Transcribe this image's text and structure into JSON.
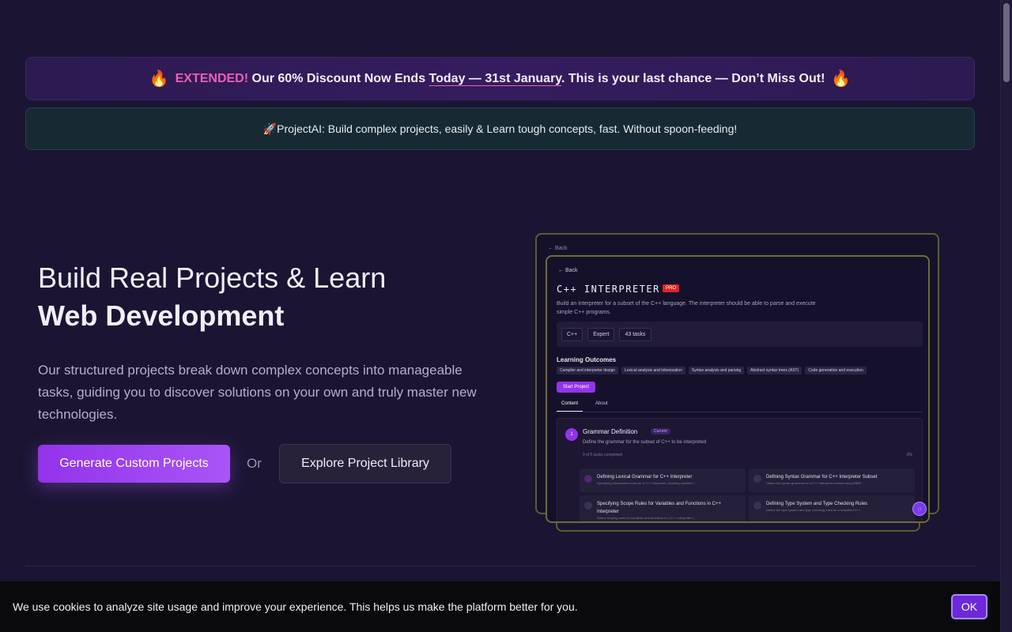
{
  "promo": {
    "flame_icon": "🔥",
    "extended": "EXTENDED!",
    "text_before": "Our 60% Discount Now Ends",
    "today": "Today — 31st January",
    "text_after": ". This is your last chance — Don’t Miss Out!"
  },
  "tagline": {
    "rocket_icon": "🚀",
    "text": "ProjectAI: Build complex projects, easily & Learn tough concepts, fast. Without spoon-feeding!"
  },
  "hero": {
    "title_line1": "Build Real Projects & Learn",
    "title_line2": "Web Development",
    "description": "Our structured projects break down complex concepts into manageable tasks, guiding you to discover solutions on your own and truly master new technologies.",
    "primary_button": "Generate Custom Projects",
    "or_text": "Or",
    "secondary_button": "Explore Project Library"
  },
  "preview": {
    "back_outer": "← Back",
    "back": "← Back",
    "title": "C++ INTERPRETER",
    "pro_badge": "PRO",
    "description": "Build an interpreter for a subset of the C++ language. The interpreter should be able to parse and execute simple C++ programs.",
    "badges": [
      "C++",
      "Expert",
      "43 tasks"
    ],
    "outcomes_heading": "Learning Outcomes",
    "outcomes": [
      "Compiler and interpreter design",
      "Lexical analysis and tokenization",
      "Syntax analysis and parsing",
      "Abstract syntax trees (AST)",
      "Code generation and execution"
    ],
    "start_button": "Start Project",
    "tabs": [
      "Content",
      "About"
    ],
    "section": {
      "number": "1",
      "title": "Grammar Definition",
      "status": "Current",
      "description": "Define the grammar for the subset of C++ to be interpreted",
      "progress": "0 of 5 tasks completed",
      "percent": "0%"
    },
    "tasks": [
      {
        "title": "Defining Lexical Grammar for C++ Interpreter",
        "desc": "Specifying tokenization rules for a C++ interpreter, including identifier..."
      },
      {
        "title": "Defining Syntax Grammar for C++ Interpreter Subset",
        "desc": "Define the syntax grammar for a C++ interpreter subset using EBNF..."
      },
      {
        "title": "Specifying Scope Rules for Variables and Functions in C++ Interpreter",
        "desc": "Define scoping rules for variables and functions in a C++ interpreter t..."
      },
      {
        "title": "Defining Type System and Type Checking Rules",
        "desc": "Define the type system and type checking rules for a simplified C++..."
      }
    ]
  },
  "cookie": {
    "text": "We use cookies to analyze site usage and improve your experience. This helps us make the platform better for you.",
    "ok_button": "OK"
  }
}
